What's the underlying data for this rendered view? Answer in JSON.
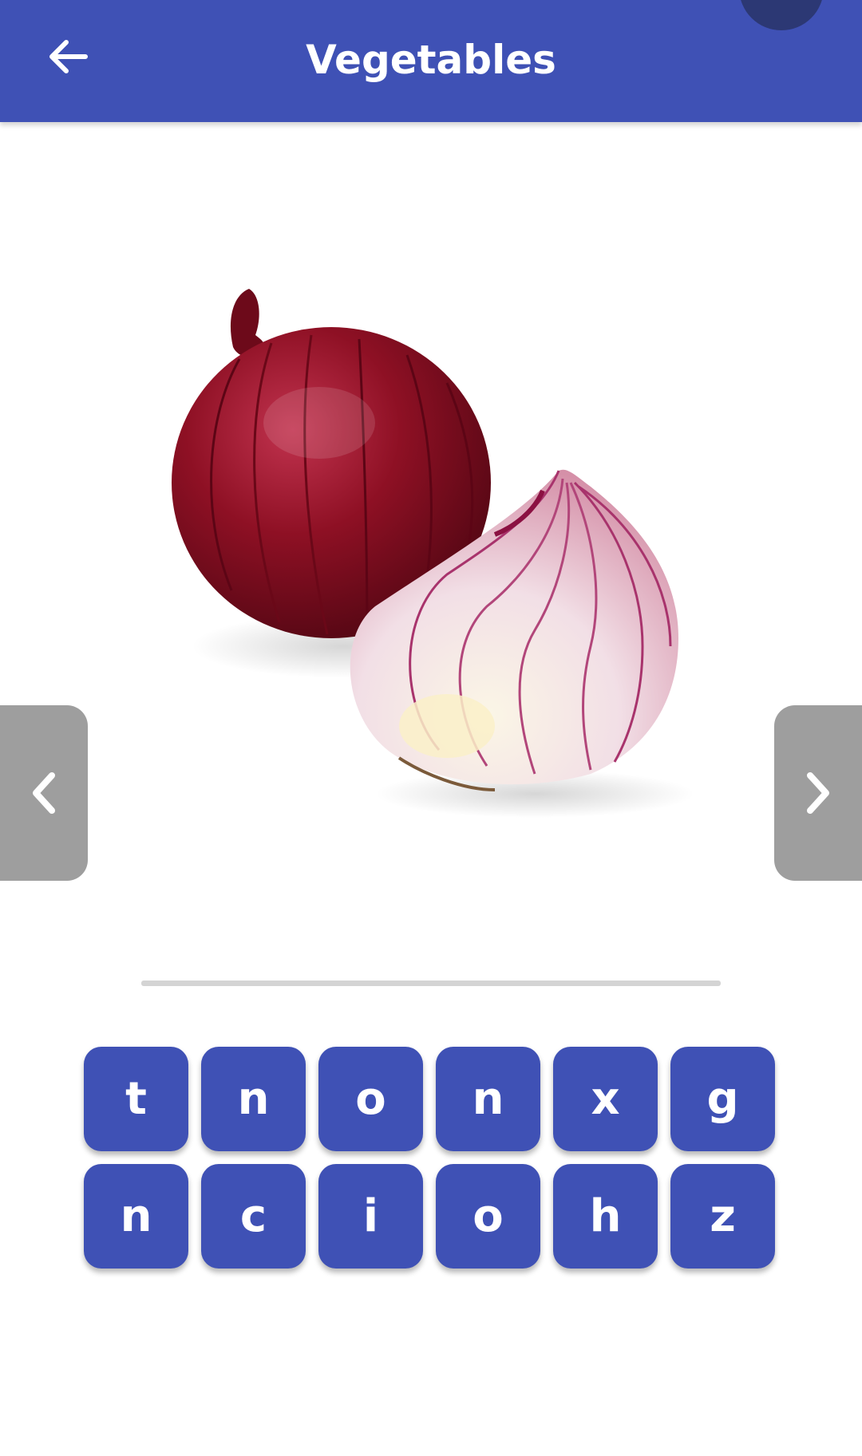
{
  "colors": {
    "primary": "#3f51b5",
    "nav_button": "#9e9e9e",
    "answer_line": "#d4d4d4"
  },
  "appbar": {
    "title": "Vegetables",
    "back_icon": "arrow-left-icon"
  },
  "picture": {
    "subject_icon": "red-onion-picture"
  },
  "nav": {
    "prev_icon": "chevron-left-icon",
    "next_icon": "chevron-right-icon"
  },
  "letter_keys": [
    [
      "t",
      "n",
      "o",
      "n",
      "x",
      "g"
    ],
    [
      "n",
      "c",
      "i",
      "o",
      "h",
      "z"
    ]
  ]
}
